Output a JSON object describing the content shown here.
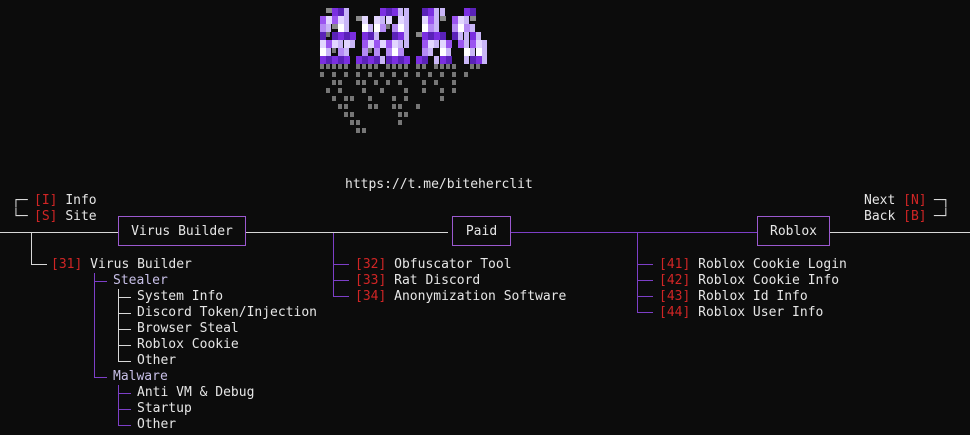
{
  "header": {
    "url": "https://t.me/biteherclit"
  },
  "left_menu": {
    "info": {
      "key": "I",
      "label": "Info"
    },
    "site": {
      "key": "S",
      "label": "Site"
    }
  },
  "right_menu": {
    "next": {
      "key": "N",
      "label": "Next"
    },
    "back": {
      "key": "B",
      "label": "Back"
    }
  },
  "sections": {
    "virus_builder": {
      "title": "Virus Builder",
      "item": {
        "num": "31",
        "label": "Virus Builder"
      },
      "stealer": {
        "label": "Stealer",
        "items": [
          "System Info",
          "Discord Token/Injection",
          "Browser Steal",
          "Roblox Cookie",
          "Other"
        ]
      },
      "malware": {
        "label": "Malware",
        "items": [
          "Anti VM & Debug",
          "Startup",
          "Other"
        ]
      }
    },
    "paid": {
      "title": "Paid",
      "items": [
        {
          "num": "32",
          "label": "Obfuscator Tool"
        },
        {
          "num": "33",
          "label": "Rat Discord"
        },
        {
          "num": "34",
          "label": "Anonymization Software"
        }
      ]
    },
    "roblox": {
      "title": "Roblox",
      "items": [
        {
          "num": "41",
          "label": "Roblox Cookie Login"
        },
        {
          "num": "42",
          "label": "Roblox Cookie Info"
        },
        {
          "num": "43",
          "label": "Roblox Id Info"
        },
        {
          "num": "44",
          "label": "Roblox User Info"
        }
      ]
    }
  },
  "colors": {
    "background": "#0c0c0c",
    "accent_purple": "#9b59d0",
    "key_red": "#d02525"
  }
}
